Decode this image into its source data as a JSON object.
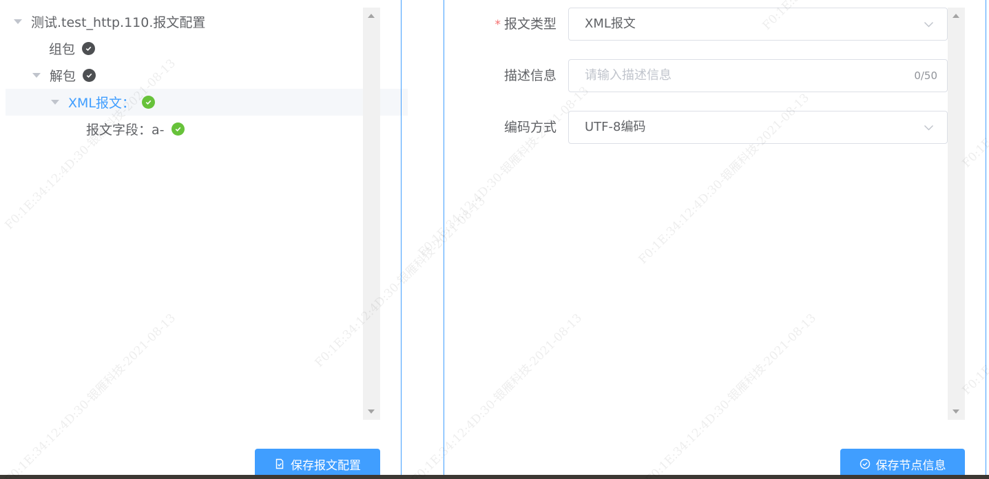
{
  "tree": {
    "root": {
      "label": "测试.test_http.110.报文配置"
    },
    "group_pack": {
      "label": "组包"
    },
    "unpack": {
      "label": "解包"
    },
    "xml_node": {
      "label": "XML报文："
    },
    "field_node": {
      "label": "报文字段：a-"
    }
  },
  "left_footer": {
    "save_label": "保存报文配置"
  },
  "form": {
    "message_type": {
      "label": "报文类型",
      "value": "XML报文"
    },
    "description": {
      "label": "描述信息",
      "placeholder": "请输入描述信息",
      "counter": "0/50"
    },
    "encoding": {
      "label": "编码方式",
      "value": "UTF-8编码"
    }
  },
  "right_footer": {
    "save_label": "保存节点信息"
  },
  "watermark": {
    "text": "F0:1E:34:12:4D:30-银雁科技-2021-08-13"
  },
  "colors": {
    "accent": "#409eff",
    "success": "#67c23a",
    "required": "#f56c6c"
  }
}
